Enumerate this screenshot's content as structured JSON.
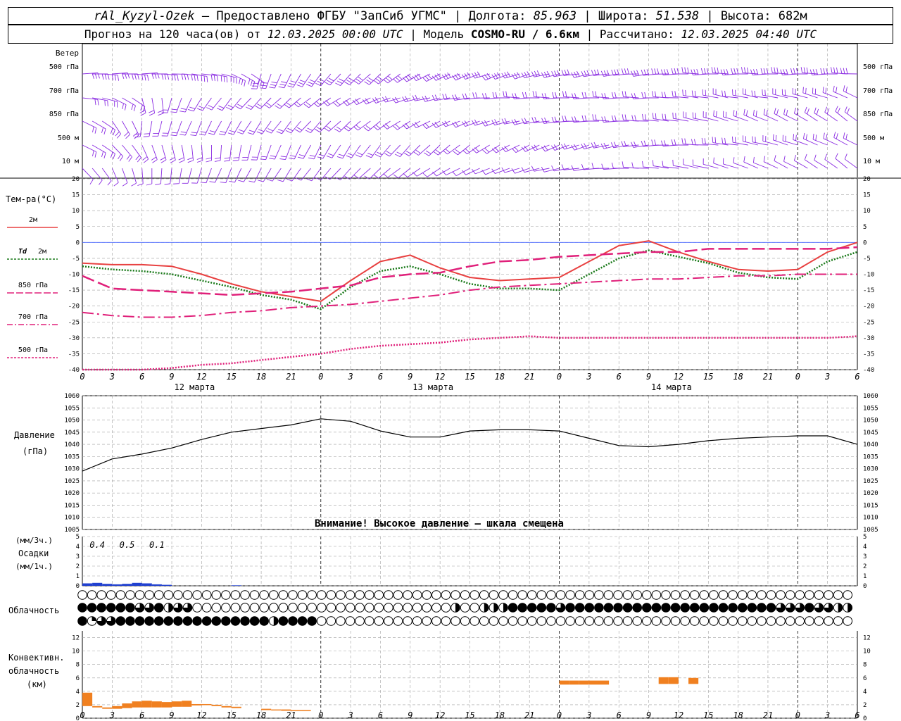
{
  "header": {
    "line1": {
      "station": "rAl_Kyzyl-Ozek",
      "provider": " – Предоставлено ФГБУ \"ЗапСиб УГМС\" | ",
      "lon_label": "Долгота: ",
      "lon_value": "85.963",
      "lat_label": " | Широта: ",
      "lat_value": "51.538",
      "alt_label": " | Высота: ",
      "alt_value": "682м"
    },
    "line2": {
      "forecast_label": "Прогноз на 120 часа(ов) от ",
      "forecast_from": "12.03.2025 00:00 UTC",
      "model_label": " | Модель ",
      "model_value": "COSMO-RU / 6.6км",
      "calc_label": " | Рассчитано: ",
      "calc_value": "12.03.2025 04:40 UTC"
    }
  },
  "wind_panel": {
    "title": "Ветер",
    "levels": [
      "500 гПа",
      "700 гПа",
      "850 гПа",
      "500 м",
      "10  м"
    ],
    "right_levels": [
      "500 гПа",
      "700 гПа",
      "850 гПа",
      "500 м",
      "10  м"
    ],
    "barb_color": "#8a2be2"
  },
  "temp_panel": {
    "title": "Тем-ра(°C)",
    "legend": [
      {
        "label": "2м",
        "italic_prefix": "",
        "color": "#e84040",
        "dash": "solid"
      },
      {
        "label": "2м",
        "italic_prefix": "Td",
        "color": "#1a7a1a",
        "dash": "dot"
      },
      {
        "label": "850 гПа",
        "italic_prefix": "",
        "color": "#e0207a",
        "dash": "longdash"
      },
      {
        "label": "700 гПа",
        "italic_prefix": "",
        "color": "#e0207a",
        "dash": "dashdot"
      },
      {
        "label": "500 гПа",
        "italic_prefix": "",
        "color": "#e0207a",
        "dash": "dotted"
      }
    ],
    "yticks": [
      "20",
      "15",
      "10",
      "5",
      "0",
      "-5",
      "-10",
      "-15",
      "-20",
      "-25",
      "-30",
      "-35",
      "-40"
    ]
  },
  "pressure_panel": {
    "title1": "Давление",
    "title2": "(гПа)",
    "warning": "Внимание! Высокое давление – шкала смещена",
    "yticks": [
      "1060",
      "1055",
      "1050",
      "1045",
      "1040",
      "1035",
      "1030",
      "1025",
      "1020",
      "1015",
      "1010",
      "1005"
    ]
  },
  "precip_panel": {
    "title1": "(мм/3ч.)",
    "title2": "Осадки",
    "title3": "(мм/1ч.)",
    "yticks": [
      "5",
      "4",
      "3",
      "2",
      "1",
      "0"
    ],
    "annotations": [
      "0.4",
      "0.5",
      "0.1"
    ]
  },
  "cloud_panel": {
    "title": "Облачность"
  },
  "conv_panel": {
    "title1": "Конвективн.",
    "title2": "облачность",
    "title3": "(км)",
    "yticks": [
      "12",
      "10",
      "8",
      "6",
      "4",
      "2",
      "0"
    ]
  },
  "time_axis": {
    "hour_labels": [
      "0",
      "3",
      "6",
      "9",
      "12",
      "15",
      "18",
      "21",
      "0",
      "3",
      "6",
      "9",
      "12",
      "15",
      "18",
      "21",
      "0",
      "3",
      "6",
      "9",
      "12",
      "15",
      "18",
      "21",
      "0",
      "3",
      "6"
    ],
    "day_labels": [
      "12 марта",
      "13 марта",
      "14 марта"
    ]
  },
  "colors": {
    "grid": "#a0a0a0",
    "pressure": "#000000",
    "precip": "#2040d0",
    "convective": "#f08020"
  },
  "chart_data": [
    {
      "type": "line",
      "name": "temperature",
      "x_unit": "hours from 12.03.2025 00:00 UTC",
      "ylim": [
        -40,
        20
      ],
      "grid": true,
      "series": [
        {
          "name": "2м",
          "x": [
            0,
            3,
            6,
            9,
            12,
            15,
            18,
            21,
            24,
            27,
            30,
            33,
            36,
            39,
            42,
            45,
            48,
            51,
            54,
            57,
            60,
            63,
            66,
            69,
            72,
            75,
            78
          ],
          "values": [
            -6.5,
            -7,
            -7,
            -7.5,
            -10,
            -13,
            -15.5,
            -17,
            -18.5,
            -12,
            -6,
            -4,
            -8,
            -11,
            -12,
            -11.5,
            -11,
            -6,
            -1,
            0.5,
            -3,
            -6,
            -8.5,
            -9,
            -8.5,
            -3,
            0
          ]
        },
        {
          "name": "Td 2м",
          "x": [
            0,
            3,
            6,
            9,
            12,
            15,
            18,
            21,
            24,
            27,
            30,
            33,
            36,
            39,
            42,
            45,
            48,
            51,
            54,
            57,
            60,
            63,
            66,
            69,
            72,
            75,
            78
          ],
          "values": [
            -7.5,
            -8.5,
            -9,
            -10,
            -12,
            -14,
            -16.5,
            -18,
            -21,
            -14,
            -9,
            -7.5,
            -10,
            -13,
            -14.5,
            -14.5,
            -15,
            -10,
            -5,
            -2.5,
            -4.5,
            -6.5,
            -9.5,
            -11,
            -11.5,
            -6,
            -3
          ]
        },
        {
          "name": "850 гПа",
          "x": [
            0,
            3,
            6,
            9,
            12,
            15,
            18,
            21,
            24,
            27,
            30,
            33,
            36,
            39,
            42,
            45,
            48,
            51,
            54,
            57,
            60,
            63,
            66,
            69,
            72,
            75,
            78
          ],
          "values": [
            -10.5,
            -14.5,
            -15,
            -15.5,
            -16,
            -16.5,
            -16,
            -15.5,
            -14.5,
            -13.5,
            -11,
            -10,
            -9.5,
            -7.5,
            -6,
            -5.5,
            -4.5,
            -4,
            -3.5,
            -3,
            -3,
            -2,
            -2,
            -2,
            -2,
            -2,
            -1.5
          ]
        },
        {
          "name": "700 гПа",
          "x": [
            0,
            3,
            6,
            9,
            12,
            15,
            18,
            21,
            24,
            27,
            30,
            33,
            36,
            39,
            42,
            45,
            48,
            51,
            54,
            57,
            60,
            63,
            66,
            69,
            72,
            75,
            78
          ],
          "values": [
            -22,
            -23,
            -23.5,
            -23.5,
            -23,
            -22,
            -21.5,
            -20.5,
            -20,
            -19.5,
            -18.5,
            -17.5,
            -16.5,
            -15,
            -14,
            -13.5,
            -13,
            -12.5,
            -12,
            -11.5,
            -11.5,
            -11,
            -10.5,
            -10.5,
            -10,
            -10,
            -10
          ]
        },
        {
          "name": "500 гПа",
          "x": [
            0,
            3,
            6,
            9,
            12,
            15,
            18,
            21,
            24,
            27,
            30,
            33,
            36,
            39,
            42,
            45,
            48,
            51,
            54,
            57,
            60,
            63,
            66,
            69,
            72,
            75,
            78
          ],
          "values": [
            -42,
            -41,
            -40.5,
            -39.5,
            -38.5,
            -38,
            -37,
            -36,
            -35,
            -33.5,
            -32.5,
            -32,
            -31.5,
            -30.5,
            -30,
            -29.5,
            -30,
            -30,
            -30,
            -30,
            -30,
            -30,
            -30,
            -30,
            -30,
            -30,
            -29.5
          ]
        }
      ]
    },
    {
      "type": "line",
      "name": "pressure",
      "x_unit": "hours from 12.03.2025 00:00 UTC",
      "ylim": [
        1005,
        1060
      ],
      "grid": true,
      "series": [
        {
          "name": "Давление",
          "x": [
            0,
            3,
            6,
            9,
            12,
            15,
            18,
            21,
            24,
            27,
            30,
            33,
            36,
            39,
            42,
            45,
            48,
            51,
            54,
            57,
            60,
            63,
            66,
            69,
            72,
            75,
            78
          ],
          "values": [
            1029,
            1034,
            1036,
            1038.5,
            1042,
            1045,
            1046.5,
            1048,
            1050.5,
            1049.5,
            1045.5,
            1043,
            1043,
            1045.5,
            1046,
            1046,
            1045.5,
            1042.5,
            1039.5,
            1039,
            1040,
            1041.5,
            1042.5,
            1043,
            1043.5,
            1043.5,
            1040
          ]
        }
      ]
    },
    {
      "type": "bar",
      "name": "precipitation",
      "x_unit": "hours from 12.03.2025 00:00 UTC",
      "ylim": [
        0,
        5
      ],
      "series": [
        {
          "name": "Осадки",
          "x": [
            0,
            1,
            2,
            3,
            4,
            5,
            6,
            7,
            8,
            15
          ],
          "values": [
            0.25,
            0.3,
            0.2,
            0.15,
            0.2,
            0.3,
            0.25,
            0.15,
            0.1,
            0.05
          ]
        }
      ]
    },
    {
      "type": "bar",
      "name": "convective cloud",
      "x_unit": "hours from 12.03.2025 00:00 UTC",
      "ylim": [
        0,
        13
      ],
      "series": [
        {
          "name": "base",
          "x": [
            0,
            1,
            2,
            3,
            4,
            5,
            6,
            7,
            8,
            9,
            10,
            11,
            12,
            13,
            14,
            15,
            18,
            19,
            20,
            21,
            22,
            48,
            49,
            50,
            51,
            52,
            58,
            59,
            61
          ],
          "values": [
            1.8,
            1.6,
            1.4,
            1.4,
            1.5,
            1.6,
            1.6,
            1.6,
            1.6,
            1.7,
            1.7,
            1.9,
            2,
            1.8,
            1.6,
            1.5,
            1.2,
            1.2,
            1.1,
            1.1,
            1.1,
            5,
            5,
            5,
            5,
            5,
            5.1,
            5.1,
            5.1
          ]
        },
        {
          "name": "top",
          "x": [
            0,
            1,
            2,
            3,
            4,
            5,
            6,
            7,
            8,
            9,
            10,
            11,
            12,
            13,
            14,
            15,
            18,
            19,
            20,
            21,
            22,
            48,
            49,
            50,
            51,
            52,
            58,
            59,
            61
          ],
          "values": [
            3.8,
            1.8,
            1.6,
            1.8,
            2.2,
            2.5,
            2.6,
            2.5,
            2.4,
            2.5,
            2.6,
            2.1,
            2.1,
            2,
            1.8,
            1.7,
            1.4,
            1.3,
            1.3,
            1.2,
            1.2,
            5.6,
            5.6,
            5.6,
            5.6,
            5.6,
            6.1,
            6.1,
            6
          ]
        }
      ]
    }
  ],
  "cloud_cover": {
    "rows": [
      "000000000000000000000000000000000000000000000000000000000000000000000000000000000",
      "444444334233000000000000000000000000000200222444443444444444444444444444433343322",
      "413344444444444444442444400000000000000000000000000000000000000000000000000000000"
    ]
  }
}
